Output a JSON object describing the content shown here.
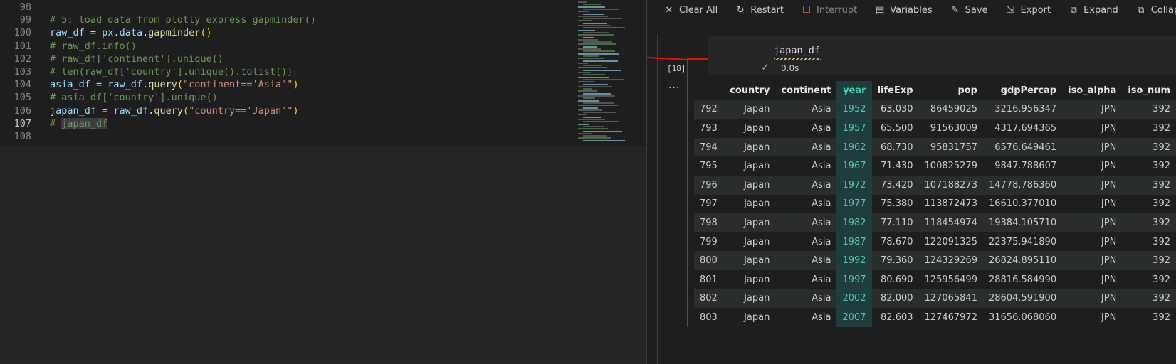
{
  "editor": {
    "lines": [
      {
        "num": "98",
        "tokens": []
      },
      {
        "num": "99",
        "tokens": [
          {
            "t": "cmt",
            "v": "# 5: load data from plotly express gapminder()"
          }
        ]
      },
      {
        "num": "100",
        "tokens": [
          {
            "t": "var",
            "v": "raw_df"
          },
          {
            "t": "op",
            "v": " = "
          },
          {
            "t": "var",
            "v": "px"
          },
          {
            "t": "op",
            "v": "."
          },
          {
            "t": "var",
            "v": "data"
          },
          {
            "t": "op",
            "v": "."
          },
          {
            "t": "fn",
            "v": "gapminder"
          },
          {
            "t": "par",
            "v": "()"
          }
        ]
      },
      {
        "num": "101",
        "tokens": [
          {
            "t": "cmt",
            "v": "# raw_df.info()"
          }
        ]
      },
      {
        "num": "102",
        "tokens": [
          {
            "t": "cmt",
            "v": "# raw_df['continent'].unique()"
          }
        ]
      },
      {
        "num": "103",
        "tokens": [
          {
            "t": "cmt",
            "v": "# len(raw_df['country'].unique().tolist())"
          }
        ]
      },
      {
        "num": "104",
        "tokens": [
          {
            "t": "var",
            "v": "asia_df"
          },
          {
            "t": "op",
            "v": " = "
          },
          {
            "t": "var",
            "v": "raw_df"
          },
          {
            "t": "op",
            "v": "."
          },
          {
            "t": "fn",
            "v": "query"
          },
          {
            "t": "par",
            "v": "("
          },
          {
            "t": "str",
            "v": "\"continent=='Asia'\""
          },
          {
            "t": "par",
            "v": ")"
          }
        ]
      },
      {
        "num": "105",
        "tokens": [
          {
            "t": "cmt",
            "v": "# asia_df['country'].unique()"
          }
        ]
      },
      {
        "num": "106",
        "tokens": [
          {
            "t": "var",
            "v": "japan_df"
          },
          {
            "t": "op",
            "v": " = "
          },
          {
            "t": "var",
            "v": "raw_df"
          },
          {
            "t": "op",
            "v": "."
          },
          {
            "t": "fn",
            "v": "query"
          },
          {
            "t": "par",
            "v": "("
          },
          {
            "t": "str",
            "v": "\"country=='Japan'\""
          },
          {
            "t": "par",
            "v": ")"
          }
        ]
      },
      {
        "num": "107",
        "tokens": [
          {
            "t": "cmt",
            "v": "# "
          },
          {
            "t": "cmt hl",
            "v": "japan_df"
          }
        ],
        "active": true
      },
      {
        "num": "108",
        "tokens": []
      }
    ]
  },
  "toolbar": [
    {
      "name": "clear-all-button",
      "icon": "✕",
      "icon_name": "close-icon",
      "label": "Clear All"
    },
    {
      "name": "restart-button",
      "icon": "↻",
      "icon_name": "restart-icon",
      "label": "Restart"
    },
    {
      "name": "interrupt-button",
      "icon": "",
      "icon_name": "stop-icon",
      "label": "Interrupt",
      "disabled": true
    },
    {
      "name": "variables-button",
      "icon": "▤",
      "icon_name": "variables-icon",
      "label": "Variables"
    },
    {
      "name": "save-button",
      "icon": "✎",
      "icon_name": "save-icon",
      "label": "Save"
    },
    {
      "name": "export-button",
      "icon": "⇲",
      "icon_name": "export-icon",
      "label": "Export"
    },
    {
      "name": "expand-button",
      "icon": "⧉",
      "icon_name": "expand-icon",
      "label": "Expand"
    },
    {
      "name": "collapse-button",
      "icon": "⧉",
      "icon_name": "collapse-icon",
      "label": "Collapse"
    }
  ],
  "cell": {
    "code": "japan_df",
    "exec_count": "[18]",
    "status_icon": "✓",
    "exec_time": "0.0s",
    "more": "..."
  },
  "table": {
    "columns": [
      "",
      "country",
      "continent",
      "year",
      "lifeExp",
      "pop",
      "gdpPercap",
      "iso_alpha",
      "iso_num"
    ],
    "rows": [
      [
        "792",
        "Japan",
        "Asia",
        "1952",
        "63.030",
        "86459025",
        "3216.956347",
        "JPN",
        "392"
      ],
      [
        "793",
        "Japan",
        "Asia",
        "1957",
        "65.500",
        "91563009",
        "4317.694365",
        "JPN",
        "392"
      ],
      [
        "794",
        "Japan",
        "Asia",
        "1962",
        "68.730",
        "95831757",
        "6576.649461",
        "JPN",
        "392"
      ],
      [
        "795",
        "Japan",
        "Asia",
        "1967",
        "71.430",
        "100825279",
        "9847.788607",
        "JPN",
        "392"
      ],
      [
        "796",
        "Japan",
        "Asia",
        "1972",
        "73.420",
        "107188273",
        "14778.786360",
        "JPN",
        "392"
      ],
      [
        "797",
        "Japan",
        "Asia",
        "1977",
        "75.380",
        "113872473",
        "16610.377010",
        "JPN",
        "392"
      ],
      [
        "798",
        "Japan",
        "Asia",
        "1982",
        "77.110",
        "118454974",
        "19384.105710",
        "JPN",
        "392"
      ],
      [
        "799",
        "Japan",
        "Asia",
        "1987",
        "78.670",
        "122091325",
        "22375.941890",
        "JPN",
        "392"
      ],
      [
        "800",
        "Japan",
        "Asia",
        "1992",
        "79.360",
        "124329269",
        "26824.895110",
        "JPN",
        "392"
      ],
      [
        "801",
        "Japan",
        "Asia",
        "1997",
        "80.690",
        "125956499",
        "28816.584990",
        "JPN",
        "392"
      ],
      [
        "802",
        "Japan",
        "Asia",
        "2002",
        "82.000",
        "127065841",
        "28604.591900",
        "JPN",
        "392"
      ],
      [
        "803",
        "Japan",
        "Asia",
        "2007",
        "82.603",
        "127467972",
        "31656.068060",
        "JPN",
        "392"
      ]
    ]
  }
}
